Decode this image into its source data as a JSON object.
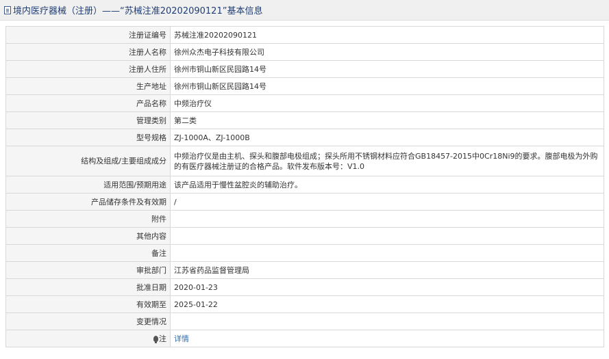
{
  "header": {
    "title": "境内医疗器械（注册）——“苏械注准20202090121”基本信息",
    "icon": "document-icon"
  },
  "rows": [
    {
      "label": "注册证编号",
      "value": "苏械注准20202090121"
    },
    {
      "label": "注册人名称",
      "value": "徐州众杰电子科技有限公司"
    },
    {
      "label": "注册人住所",
      "value": "徐州市铜山新区民园路14号"
    },
    {
      "label": "生产地址",
      "value": "徐州市铜山新区民园路14号"
    },
    {
      "label": "产品名称",
      "value": "中频治疗仪"
    },
    {
      "label": "管理类别",
      "value": "第二类"
    },
    {
      "label": "型号规格",
      "value": "ZJ-1000A、ZJ-1000B"
    },
    {
      "label": "结构及组成/主要组成成分",
      "value": "中频治疗仪是由主机、探头和腹部电极组成；探头所用不锈钢材料应符合GB18457-2015中0Cr18Ni9的要求。腹部电极为外购的有医疗器械注册证的合格产品。软件发布版本号：V1.0"
    },
    {
      "label": "适用范围/预期用途",
      "value": "该产品适用于慢性盆腔炎的辅助治疗。"
    },
    {
      "label": "产品储存条件及有效期",
      "value": "/"
    },
    {
      "label": "附件",
      "value": ""
    },
    {
      "label": "其他内容",
      "value": ""
    },
    {
      "label": "备注",
      "value": ""
    },
    {
      "label": "审批部门",
      "value": "江苏省药品监督管理局"
    },
    {
      "label": "批准日期",
      "value": "2020-01-23"
    },
    {
      "label": "有效期至",
      "value": "2025-01-22"
    },
    {
      "label": "变更情况",
      "value": ""
    }
  ],
  "note": {
    "label": "注",
    "value": "详情",
    "icon": "lightbulb-icon"
  }
}
